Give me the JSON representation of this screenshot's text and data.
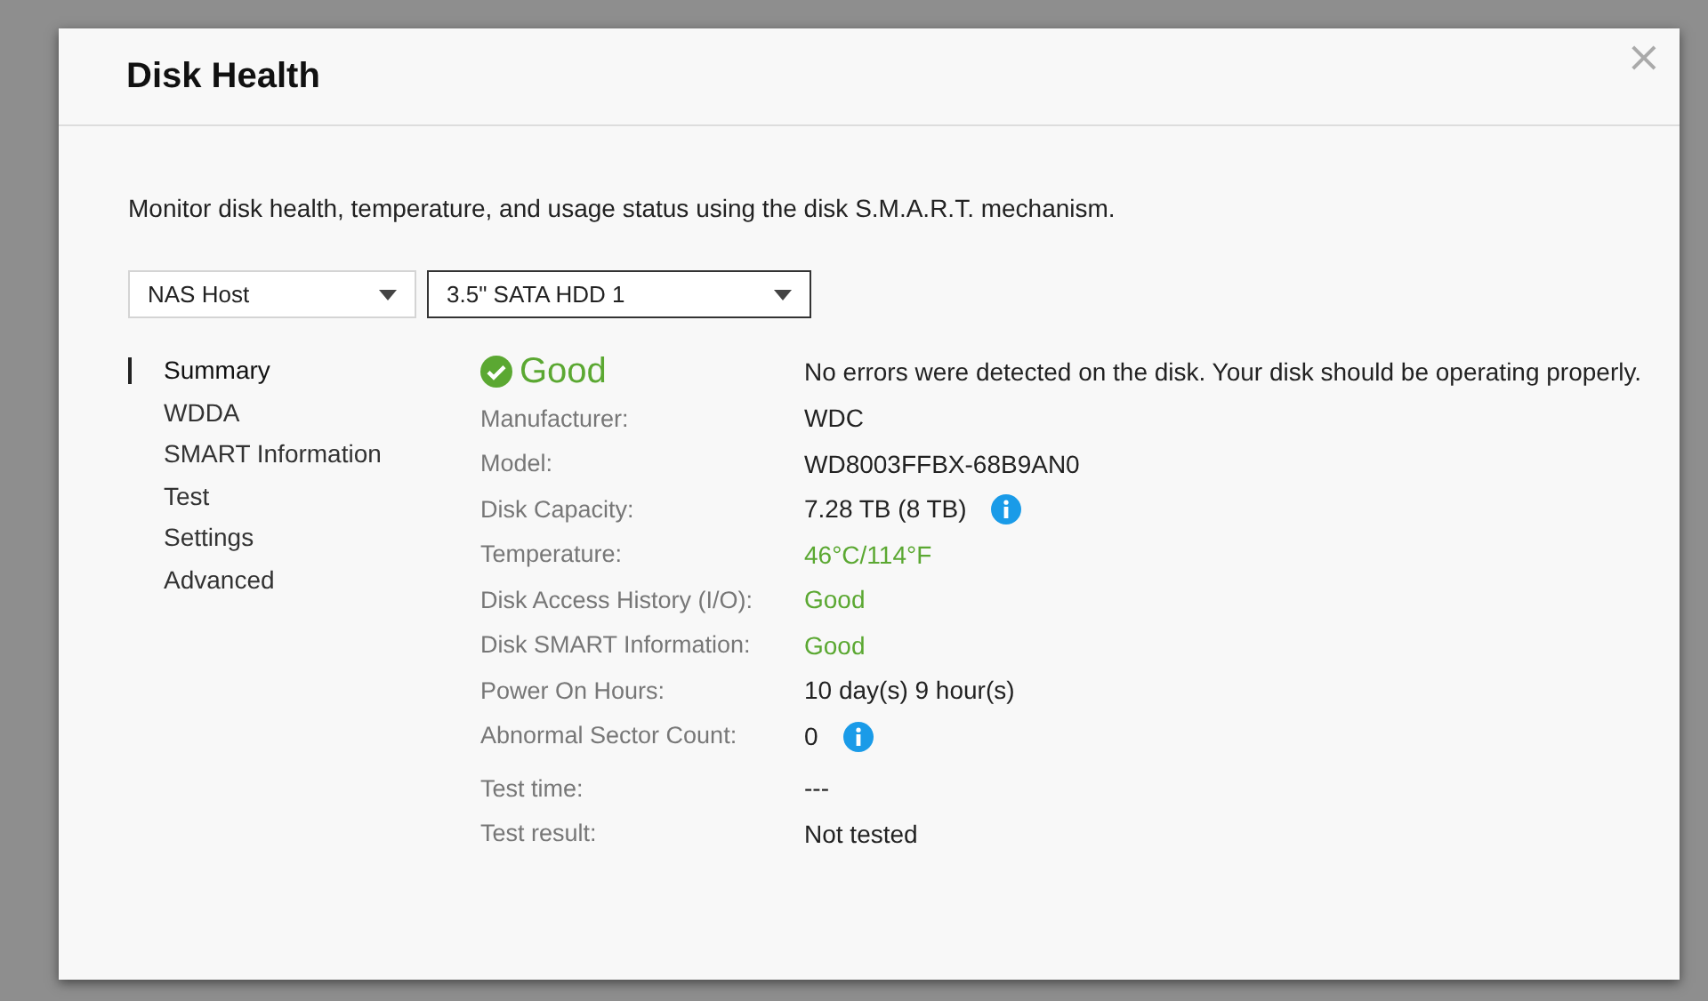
{
  "dialog": {
    "title": "Disk Health",
    "close": "×"
  },
  "description": "Monitor disk health, temperature, and usage status using the disk S.M.A.R.T. mechanism.",
  "selectors": [
    {
      "value": "NAS Host",
      "focused": false
    },
    {
      "value": "3.5\" SATA HDD 1",
      "focused": true
    }
  ],
  "nav": [
    {
      "label": "Summary",
      "selected": true
    },
    {
      "label": "WDDA",
      "selected": false
    },
    {
      "label": "SMART Information",
      "selected": false
    },
    {
      "label": "Test",
      "selected": false
    },
    {
      "label": "Settings",
      "selected": false
    },
    {
      "label": "Advanced",
      "selected": false
    }
  ],
  "status": {
    "label": "Good",
    "message": "No errors were detected on the disk. Your disk should be operating properly."
  },
  "rows": [
    {
      "label": "Manufacturer:",
      "value": "WDC"
    },
    {
      "label": "Model:",
      "value": "WD8003FFBX-68B9AN0"
    },
    {
      "label": "Disk Capacity:",
      "value": "7.28 TB (8 TB)",
      "info": true
    },
    {
      "label": "Temperature:",
      "value": "46°C/114°F",
      "color": "#5ba832"
    },
    {
      "label": "Disk Access History (I/O):",
      "value": "Good",
      "color": "#5ba832"
    },
    {
      "label": "Disk SMART Information:",
      "value": "Good",
      "color": "#5ba832"
    },
    {
      "label": "Power On Hours:",
      "value": "10 day(s) 9 hour(s)"
    },
    {
      "label": "Abnormal Sector Count:",
      "value": "0",
      "info": true
    },
    {
      "label": "Test time:",
      "value": "---"
    },
    {
      "label": "Test result:",
      "value": "Not tested"
    }
  ]
}
